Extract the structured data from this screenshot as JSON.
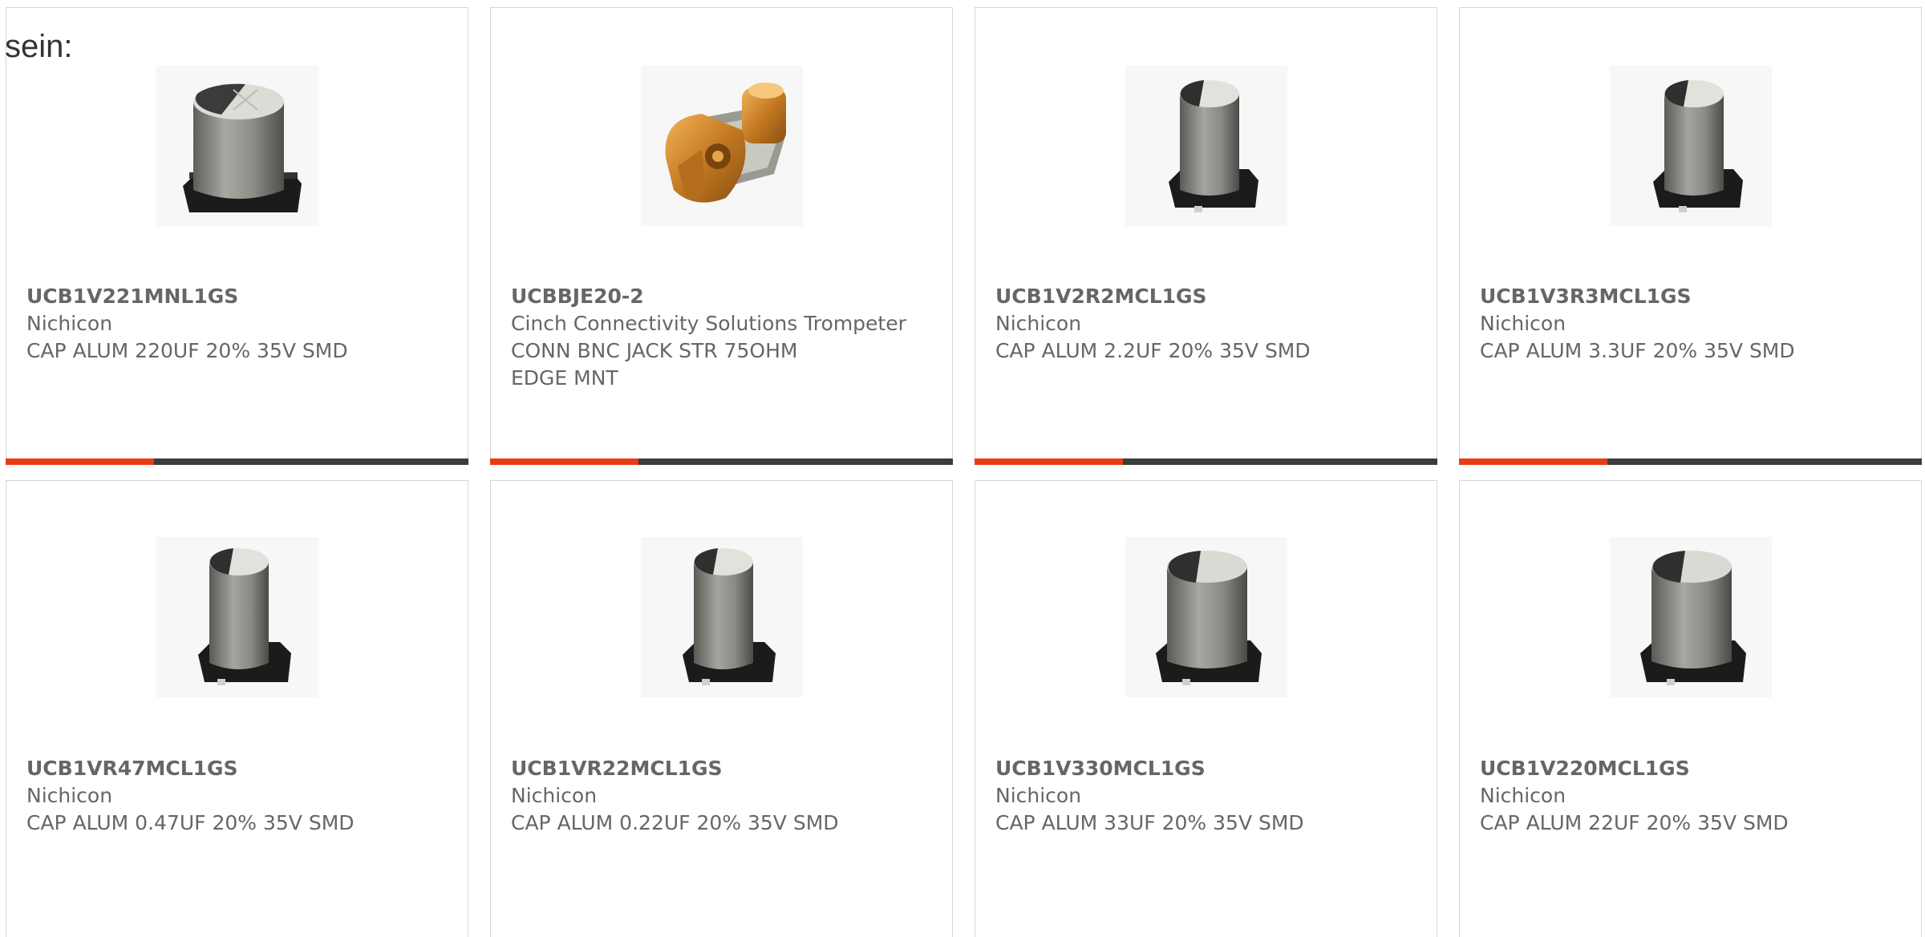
{
  "intro": {
    "text": "sein:"
  },
  "colors": {
    "accent": "#e83c14",
    "bar_dark": "#3c3c3c",
    "text": "#666666",
    "card_border": "#d6d6d6"
  },
  "products": [
    {
      "part_number": "UCB1V221MNL1GS",
      "manufacturer": "Nichicon",
      "description": "CAP ALUM 220UF 20% 35V SMD",
      "description_2": "",
      "image": "electrolytic-capacitor-large-image",
      "progress": 0.32
    },
    {
      "part_number": "UCBBJE20-2",
      "manufacturer": "Cinch Connectivity Solutions Trompeter",
      "description": "CONN BNC JACK STR 75OHM",
      "description_2": "EDGE MNT",
      "image": "bnc-connector-image",
      "progress": 0.32
    },
    {
      "part_number": "UCB1V2R2MCL1GS",
      "manufacturer": "Nichicon",
      "description": "CAP ALUM 2.2UF 20% 35V SMD",
      "description_2": "",
      "image": "electrolytic-capacitor-small-image",
      "progress": 0.32
    },
    {
      "part_number": "UCB1V3R3MCL1GS",
      "manufacturer": "Nichicon",
      "description": "CAP ALUM 3.3UF 20% 35V SMD",
      "description_2": "",
      "image": "electrolytic-capacitor-small-image",
      "progress": 0.32
    },
    {
      "part_number": "UCB1VR47MCL1GS",
      "manufacturer": "Nichicon",
      "description": "CAP ALUM 0.47UF 20% 35V SMD",
      "description_2": "",
      "image": "electrolytic-capacitor-small-image"
    },
    {
      "part_number": "UCB1VR22MCL1GS",
      "manufacturer": "Nichicon",
      "description": "CAP ALUM 0.22UF 20% 35V SMD",
      "description_2": "",
      "image": "electrolytic-capacitor-small-image"
    },
    {
      "part_number": "UCB1V330MCL1GS",
      "manufacturer": "Nichicon",
      "description": "CAP ALUM 33UF 20% 35V SMD",
      "description_2": "",
      "image": "electrolytic-capacitor-medium-image"
    },
    {
      "part_number": "UCB1V220MCL1GS",
      "manufacturer": "Nichicon",
      "description": "CAP ALUM 22UF 20% 35V SMD",
      "description_2": "",
      "image": "electrolytic-capacitor-medium-image"
    }
  ]
}
